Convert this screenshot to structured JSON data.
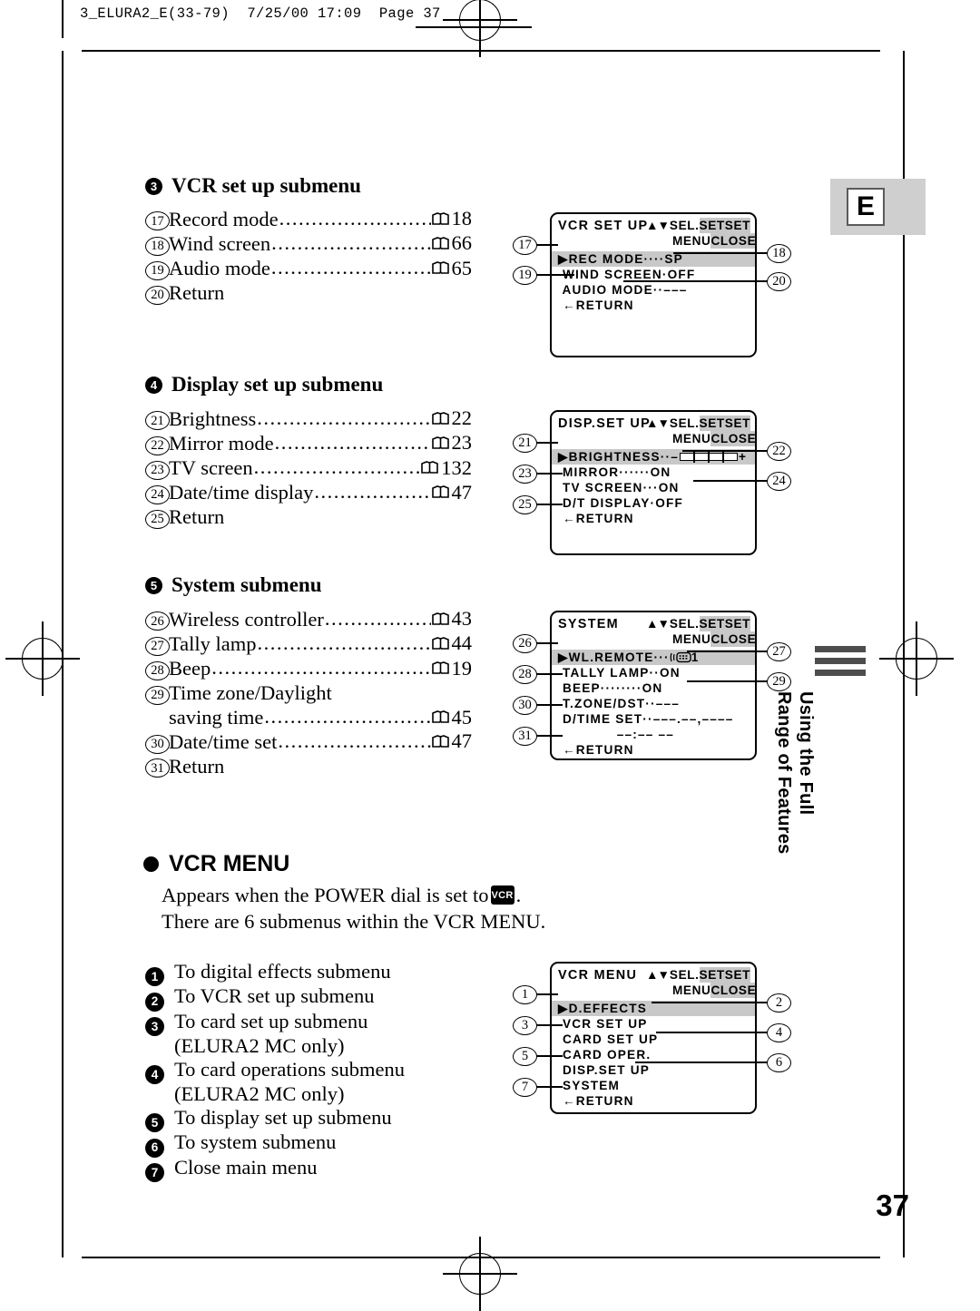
{
  "runhead": {
    "text": "3_ELURA2_E(33-79)  7/25/00 17:09  Page 37"
  },
  "badge": {
    "letter": "E"
  },
  "page_number": "37",
  "side_tab": {
    "text": "Using the Full\nRange of Features"
  },
  "sections": [
    {
      "number": "3",
      "title": "VCR set up submenu",
      "items": [
        {
          "num": "17",
          "label": "Record mode",
          "page": "18"
        },
        {
          "num": "18",
          "label": "Wind screen",
          "page": "66"
        },
        {
          "num": "19",
          "label": "Audio mode",
          "page": "65"
        },
        {
          "num": "20",
          "label": "Return",
          "page": ""
        }
      ]
    },
    {
      "number": "4",
      "title": "Display set up submenu",
      "items": [
        {
          "num": "21",
          "label": "Brightness",
          "page": "22"
        },
        {
          "num": "22",
          "label": "Mirror mode",
          "page": "23"
        },
        {
          "num": "23",
          "label": "TV screen",
          "page": "132"
        },
        {
          "num": "24",
          "label": "Date/time display",
          "page": "47"
        },
        {
          "num": "25",
          "label": "Return",
          "page": ""
        }
      ]
    },
    {
      "number": "5",
      "title": "System submenu",
      "items": [
        {
          "num": "26",
          "label": "Wireless controller",
          "page": "43"
        },
        {
          "num": "27",
          "label": "Tally lamp",
          "page": "44"
        },
        {
          "num": "28",
          "label": "Beep",
          "page": "19"
        },
        {
          "num": "29",
          "label": "Time zone/Daylight",
          "page": "",
          "cont_label": "saving time",
          "cont_page": "45"
        },
        {
          "num": "30",
          "label": "Date/time set",
          "page": "47"
        },
        {
          "num": "31",
          "label": "Return",
          "page": ""
        }
      ]
    }
  ],
  "screens": {
    "vcr_setup": {
      "title": "VCR SET UP",
      "sel_line1_a": "SEL.",
      "sel_line1_b": "SETSET",
      "sel_line2_a": "MENU",
      "sel_line2_b": "CLOSE",
      "rows": [
        {
          "text": "▶REC MODE····SP",
          "highlight": true
        },
        {
          "text": " WIND SCREEN·OFF",
          "highlight": false
        },
        {
          "text": " AUDIO MODE··–––",
          "highlight": false
        },
        {
          "text": " ←RETURN",
          "highlight": false
        }
      ],
      "callouts_left": [
        "17",
        "19"
      ],
      "callouts_right": [
        "18",
        "20"
      ]
    },
    "disp_setup": {
      "title": "DISP.SET UP",
      "sel_line1_a": "SEL.",
      "sel_line1_b": "SETSET",
      "sel_line2_a": "MENU",
      "sel_line2_b": "CLOSE",
      "brightness_label": "▶BRIGHTNESS··–",
      "brightness_plus": "+",
      "rows": [
        {
          "text": " MIRROR······ON",
          "highlight": false
        },
        {
          "text": " TV SCREEN···ON",
          "highlight": false
        },
        {
          "text": " D/T DISPLAY·OFF",
          "highlight": false
        },
        {
          "text": " ←RETURN",
          "highlight": false
        }
      ],
      "callouts_left": [
        "21",
        "23",
        "25"
      ],
      "callouts_right": [
        "22",
        "24"
      ]
    },
    "system": {
      "title": "SYSTEM",
      "sel_line1_a": "SEL.",
      "sel_line1_b": "SETSET",
      "sel_line2_a": "MENU",
      "sel_line2_b": "CLOSE",
      "remote_row_prefix": "▶WL.REMOTE···",
      "remote_row_suffix": "1",
      "rows": [
        {
          "text": " TALLY LAMP··ON",
          "highlight": false
        },
        {
          "text": " BEEP········ON",
          "highlight": false
        },
        {
          "text": " T.ZONE/DST··–––",
          "highlight": false
        },
        {
          "text": " D/TIME SET··–––.––,––––",
          "highlight": false
        },
        {
          "text": "             ––:–– ––",
          "highlight": false
        },
        {
          "text": " ←RETURN",
          "highlight": false
        }
      ],
      "callouts_left": [
        "26",
        "28",
        "30",
        "31"
      ],
      "callouts_right": [
        "27",
        "29"
      ]
    },
    "vcr_menu": {
      "title": "VCR MENU",
      "sel_line1_a": "SEL.",
      "sel_line1_b": "SETSET",
      "sel_line2_a": "MENU",
      "sel_line2_b": "CLOSE",
      "rows": [
        {
          "text": "▶D.EFFECTS",
          "highlight": true
        },
        {
          "text": " VCR SET UP",
          "highlight": false
        },
        {
          "text": " CARD SET UP",
          "highlight": false
        },
        {
          "text": " CARD OPER.",
          "highlight": false
        },
        {
          "text": " DISP.SET UP",
          "highlight": false
        },
        {
          "text": " SYSTEM",
          "highlight": false
        },
        {
          "text": " ←RETURN",
          "highlight": false
        }
      ],
      "callouts_left": [
        "1",
        "3",
        "5",
        "7"
      ],
      "callouts_right": [
        "2",
        "4",
        "6"
      ]
    }
  },
  "vcr_menu_block": {
    "heading": "VCR MENU",
    "para_line1_a": "Appears when the POWER dial is set to",
    "chip": "VCR",
    "para_line1_b": ".",
    "para_line2": "There are 6 submenus within the VCR MENU.",
    "items": [
      {
        "num": "1",
        "label": "To digital effects submenu",
        "sub": ""
      },
      {
        "num": "2",
        "label": "To VCR set up submenu",
        "sub": ""
      },
      {
        "num": "3",
        "label": "To card set up submenu",
        "sub": "(ELURA2 MC only)"
      },
      {
        "num": "4",
        "label": "To card operations submenu",
        "sub": "(ELURA2 MC only)"
      },
      {
        "num": "5",
        "label": "To display set up submenu",
        "sub": ""
      },
      {
        "num": "6",
        "label": "To system submenu",
        "sub": ""
      },
      {
        "num": "7",
        "label": "Close main menu",
        "sub": ""
      }
    ]
  },
  "dots": "..........................................."
}
